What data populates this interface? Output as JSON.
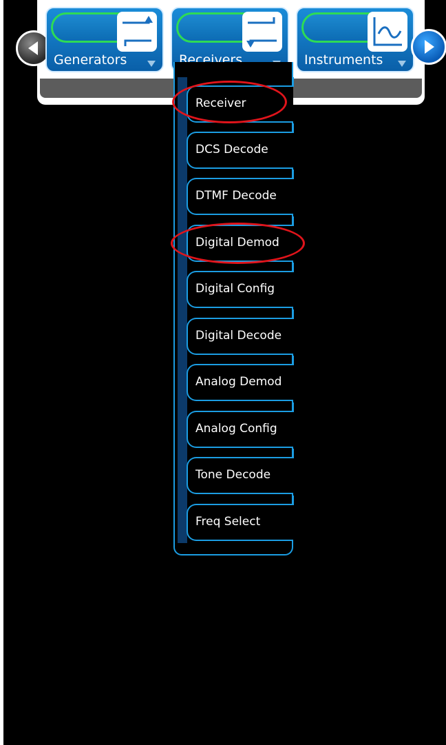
{
  "tabs": [
    {
      "label": "Generators",
      "icon": "generators-icon"
    },
    {
      "label": "Receivers",
      "icon": "receivers-icon"
    },
    {
      "label": "Instruments",
      "icon": "instruments-icon"
    }
  ],
  "nav": {
    "left_icon": "arrow-left-icon",
    "right_icon": "arrow-right-icon"
  },
  "menu": {
    "items": [
      {
        "label": "Receiver",
        "highlighted": true
      },
      {
        "label": "DCS Decode",
        "highlighted": false
      },
      {
        "label": "DTMF Decode",
        "highlighted": false
      },
      {
        "label": "Digital Demod",
        "highlighted": true
      },
      {
        "label": "Digital Config",
        "highlighted": false
      },
      {
        "label": "Digital Decode",
        "highlighted": false
      },
      {
        "label": "Analog Demod",
        "highlighted": false
      },
      {
        "label": "Analog Config",
        "highlighted": false
      },
      {
        "label": "Tone Decode",
        "highlighted": false
      },
      {
        "label": "Freq Select",
        "highlighted": false
      }
    ]
  },
  "colors": {
    "accent": "#1b9de3",
    "tab_bg": "#0a6fba",
    "pill_green": "#2edb55",
    "highlight_red": "#e0141b",
    "background": "#000000"
  }
}
